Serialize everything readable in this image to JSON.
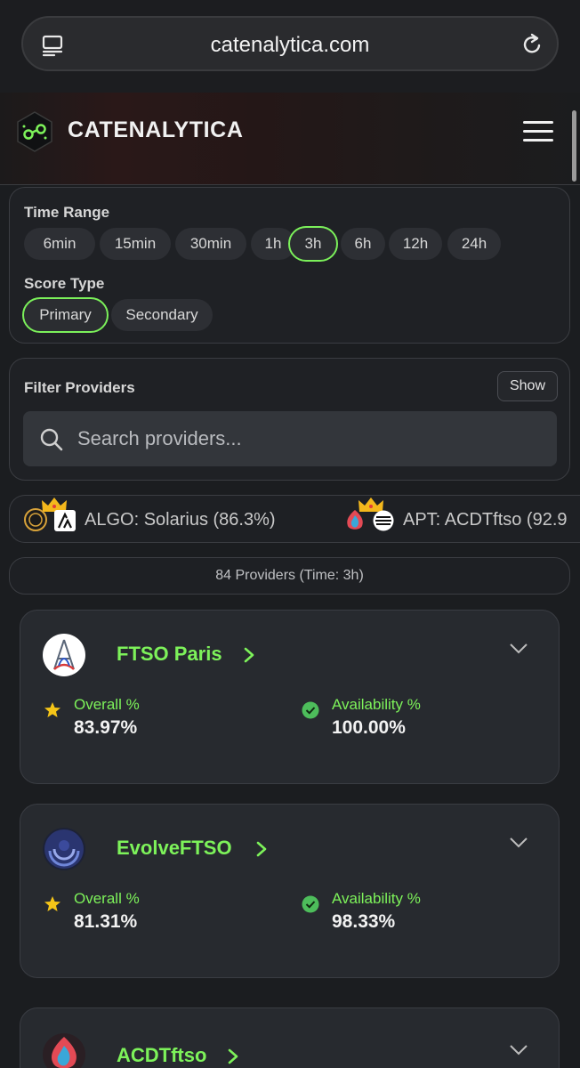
{
  "browser": {
    "url": "catenalytica.com"
  },
  "app": {
    "brand": "CATENALYTICA"
  },
  "time_range": {
    "label": "Time Range",
    "options": [
      "6min",
      "15min",
      "30min",
      "1h",
      "3h",
      "6h",
      "12h",
      "24h"
    ],
    "selected": "3h"
  },
  "score_type": {
    "label": "Score Type",
    "options": [
      "Primary",
      "Secondary"
    ],
    "selected": "Primary"
  },
  "filter": {
    "label": "Filter Providers",
    "show_label": "Show",
    "search_placeholder": "Search providers..."
  },
  "ticker": {
    "items": [
      {
        "text": "ALGO: Solarius (86.3%)",
        "icon": "crown-icon"
      },
      {
        "text": "APT: ACDTftso (92.9",
        "icon": "crown-icon"
      }
    ]
  },
  "summary": {
    "count_text": "84 Providers (Time: 3h)"
  },
  "providers": [
    {
      "name": "FTSO Paris",
      "overall_label": "Overall %",
      "overall": "83.97%",
      "availability_label": "Availability %",
      "availability": "100.00%"
    },
    {
      "name": "EvolveFTSO",
      "overall_label": "Overall %",
      "overall": "81.31%",
      "availability_label": "Availability %",
      "availability": "98.33%"
    },
    {
      "name": "ACDTftso"
    }
  ],
  "colors": {
    "accent": "#7df25a",
    "background": "#1b1d20",
    "card": "#272a2f",
    "star": "#f5c518"
  }
}
